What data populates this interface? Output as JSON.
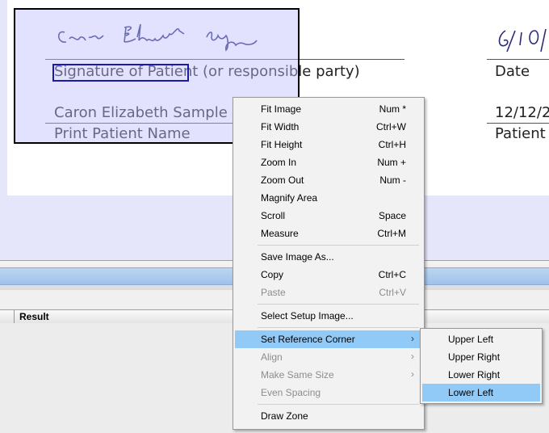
{
  "document": {
    "signature_caption": "Signature of Patient",
    "signature_caption_suffix": " (or responsible party)",
    "date_label": "Date",
    "printed_name": "Caron Elizabeth Sample",
    "print_name_label": "Print Patient Name",
    "date_value": "12/12/2",
    "patient_label": "Patient",
    "handwritten_signature": "Caron Elizabeth Sample",
    "handwritten_date": "6/10/"
  },
  "results_grid": {
    "columns": [
      "Result"
    ]
  },
  "context_menu": {
    "items": [
      {
        "label": "Fit Image",
        "shortcut": "Num *"
      },
      {
        "label": "Fit Width",
        "shortcut": "Ctrl+W"
      },
      {
        "label": "Fit Height",
        "shortcut": "Ctrl+H"
      },
      {
        "label": "Zoom In",
        "shortcut": "Num +"
      },
      {
        "label": "Zoom Out",
        "shortcut": "Num -"
      },
      {
        "label": "Magnify Area",
        "shortcut": ""
      },
      {
        "label": "Scroll",
        "shortcut": "Space"
      },
      {
        "label": "Measure",
        "shortcut": "Ctrl+M"
      },
      {
        "label": "Save Image As...",
        "shortcut": ""
      },
      {
        "label": "Copy",
        "shortcut": "Ctrl+C"
      },
      {
        "label": "Paste",
        "shortcut": "Ctrl+V",
        "disabled": true
      },
      {
        "label": "Select Setup Image...",
        "shortcut": ""
      },
      {
        "label": "Set Reference Corner",
        "submenu": true,
        "highlighted": true
      },
      {
        "label": "Align",
        "submenu": true,
        "disabled": true
      },
      {
        "label": "Make Same Size",
        "submenu": true,
        "disabled": true
      },
      {
        "label": "Even Spacing",
        "disabled": true
      },
      {
        "label": "Draw Zone",
        "shortcut": ""
      }
    ]
  },
  "reference_corner_submenu": {
    "items": [
      {
        "label": "Upper Left"
      },
      {
        "label": "Upper Right"
      },
      {
        "label": "Lower Right"
      },
      {
        "label": "Lower Left",
        "highlighted": true
      }
    ]
  },
  "colors": {
    "highlight": "#91c9f7",
    "zone_border": "#cc0000",
    "viewer_background": "#e6e6fa"
  }
}
